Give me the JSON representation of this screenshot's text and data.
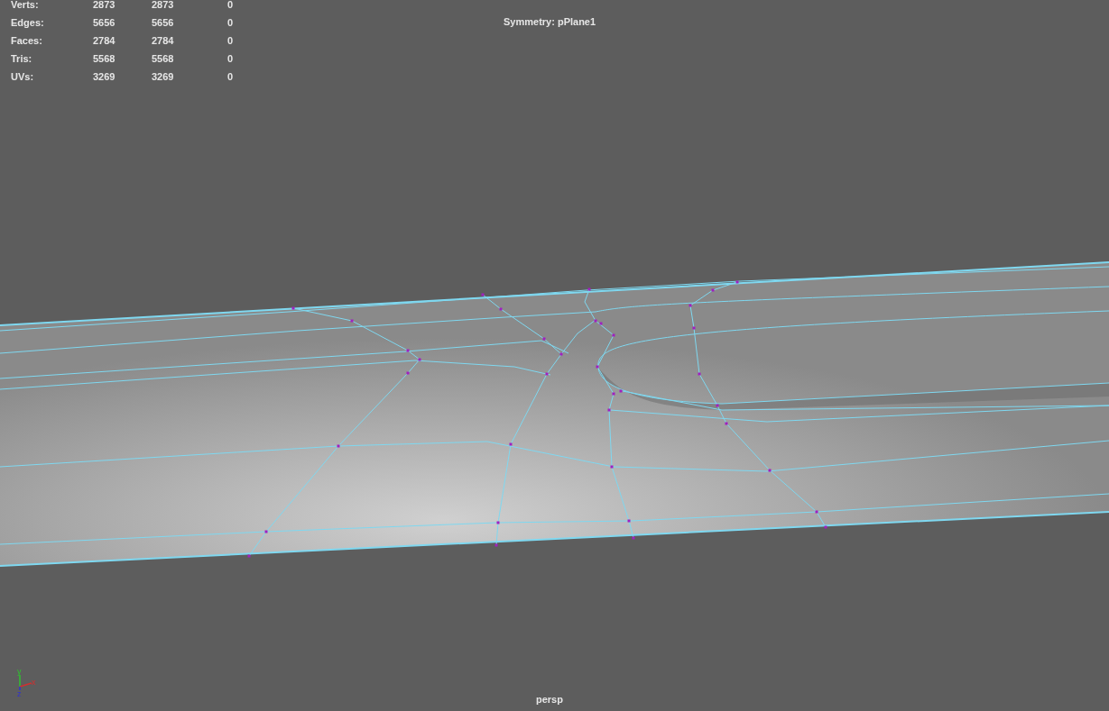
{
  "stats": [
    {
      "label": "Verts:",
      "values": [
        "2873",
        "2873",
        "0"
      ]
    },
    {
      "label": "Edges:",
      "values": [
        "5656",
        "5656",
        "0"
      ]
    },
    {
      "label": "Faces:",
      "values": [
        "2784",
        "2784",
        "0"
      ]
    },
    {
      "label": "Tris:",
      "values": [
        "5568",
        "5568",
        "0"
      ]
    },
    {
      "label": "UVs:",
      "values": [
        "3269",
        "3269",
        "0"
      ]
    }
  ],
  "symmetry": "Symmetry: pPlane1",
  "axis": {
    "y": "y",
    "x": "x",
    "z": "z"
  },
  "camera": "persp"
}
